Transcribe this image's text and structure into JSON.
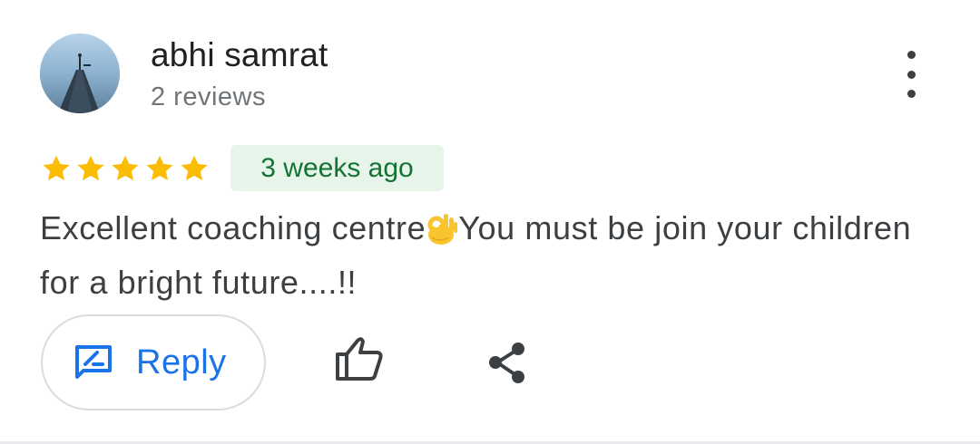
{
  "review": {
    "author": {
      "name": "abhi samrat",
      "reviews_count": "2 reviews"
    },
    "rating": {
      "value": 5,
      "max": 5
    },
    "time_ago": "3 weeks ago",
    "text_before_emoji": "Excellent coaching centre",
    "text_after_emoji": "You must be join your children for a bright future....!!",
    "emoji": "ok-hand-emoji"
  },
  "actions": {
    "reply_label": "Reply",
    "reply_icon": "rate-review-icon",
    "like_icon": "thumb-up-icon",
    "share_icon": "share-icon",
    "more_icon": "more-vertical-icon"
  },
  "colors": {
    "star": "#fbbc04",
    "accent": "#1a73e8",
    "badge_bg": "#e6f4ea",
    "badge_text": "#137333"
  }
}
